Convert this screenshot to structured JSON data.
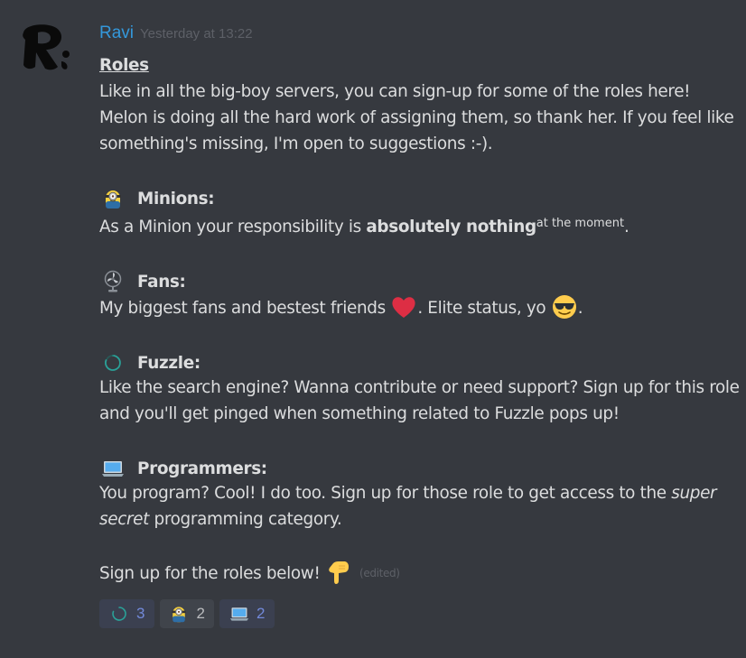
{
  "message": {
    "author": "Ravi",
    "timestamp": "Yesterday at 13:22",
    "avatar_letter": "R",
    "title": "Roles",
    "intro": "Like in all the big-boy servers, you can sign-up for some of the roles here! Melon is doing all the hard work of assigning them, so thank her. If you feel like something's missing, I'm open to suggestions :-).",
    "roles": [
      {
        "icon": "minion-emoji",
        "name": "Minions:",
        "desc_pre": "As a Minion your responsibility is ",
        "desc_bold": "absolutely nothing",
        "desc_sup": "at the moment",
        "desc_post": "."
      },
      {
        "icon": "fan-emoji",
        "name": "Fans:",
        "desc_pre": "My biggest fans and bestest friends ",
        "desc_mid": ". Elite status, yo ",
        "desc_post": ".",
        "inline_icons": [
          "heart-emoji",
          "sunglasses-emoji"
        ]
      },
      {
        "icon": "fuzzle-emoji",
        "name": "Fuzzle:",
        "desc": "Like the search engine? Wanna contribute or need support? Sign up for this role and you'll get pinged when something related to Fuzzle pops up!"
      },
      {
        "icon": "laptop-emoji",
        "name": "Programmers:",
        "desc_pre": "You program? Cool! I do too. Sign up for those role to get access to the ",
        "desc_italic": "super secret",
        "desc_post": " programming category."
      }
    ],
    "outro": "Sign up for the roles below! ",
    "outro_icon": "point-down-emoji",
    "edited_label": "(edited)"
  },
  "reactions": [
    {
      "icon": "fuzzle-emoji",
      "count": "3",
      "active": true
    },
    {
      "icon": "minion-emoji",
      "count": "2",
      "active": false
    },
    {
      "icon": "laptop-emoji",
      "count": "2",
      "active": true
    }
  ],
  "colors": {
    "background": "#36393f",
    "username": "#3498db",
    "text": "#dcddde",
    "timestamp": "#5d6067",
    "reaction_active_count": "#7289da"
  }
}
